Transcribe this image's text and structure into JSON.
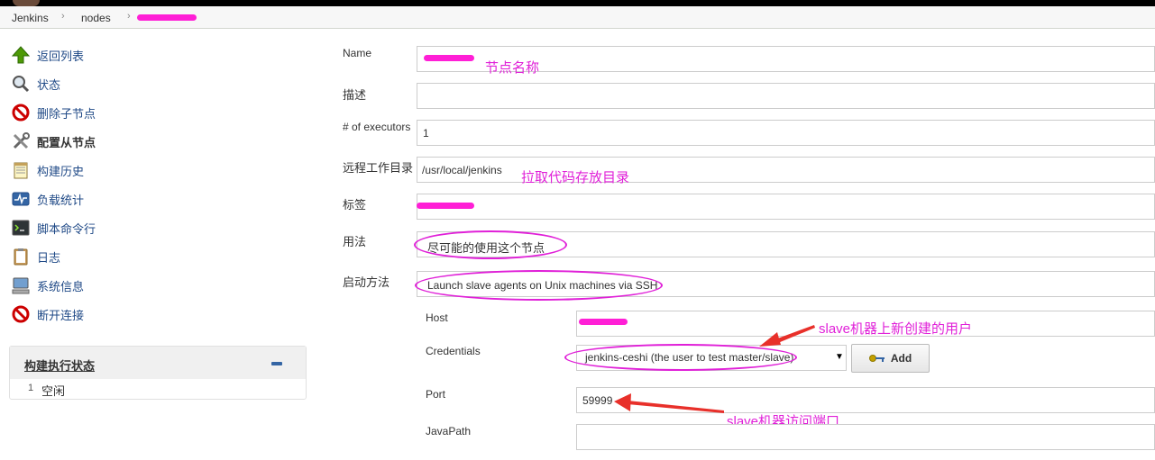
{
  "breadcrumb": {
    "items": [
      "Jenkins",
      "nodes"
    ]
  },
  "sidebar": {
    "items": [
      {
        "label": "返回列表",
        "icon": "up-arrow-icon"
      },
      {
        "label": "状态",
        "icon": "magnifier-icon"
      },
      {
        "label": "删除子节点",
        "icon": "no-entry-icon"
      },
      {
        "label": "配置从节点",
        "icon": "tools-icon"
      },
      {
        "label": "构建历史",
        "icon": "notepad-icon"
      },
      {
        "label": "负载统计",
        "icon": "monitor-graph-icon"
      },
      {
        "label": "脚本命令行",
        "icon": "terminal-icon"
      },
      {
        "label": "日志",
        "icon": "clipboard-icon"
      },
      {
        "label": "系统信息",
        "icon": "computer-icon"
      },
      {
        "label": "断开连接",
        "icon": "no-entry-icon"
      }
    ]
  },
  "executor": {
    "title": "构建执行状态",
    "rows": [
      {
        "num": "1",
        "status": "空闲"
      }
    ]
  },
  "form": {
    "name_label": "Name",
    "desc_label": "描述",
    "executors_label": "# of executors",
    "executors_value": "1",
    "remote_dir_label": "远程工作目录",
    "remote_dir_value": "/usr/local/jenkins",
    "labels_label": "标签",
    "usage_label": "用法",
    "usage_value": "尽可能的使用这个节点",
    "launch_label": "启动方法",
    "launch_value": "Launch slave agents on Unix machines via SSH",
    "host_label": "Host",
    "credentials_label": "Credentials",
    "credentials_value": "jenkins-ceshi (the user to test master/slave)",
    "add_label": "Add",
    "port_label": "Port",
    "port_value": "59999",
    "javapath_label": "JavaPath"
  },
  "annotations": {
    "node_name": "节点名称",
    "remote_dir": "拉取代码存放目录",
    "slave_user": "slave机器上新创建的用户",
    "slave_port": "slave机器访问端口"
  },
  "colors": {
    "annotation": "#e020d8",
    "arrow": "#e8302a",
    "link": "#204a87"
  }
}
